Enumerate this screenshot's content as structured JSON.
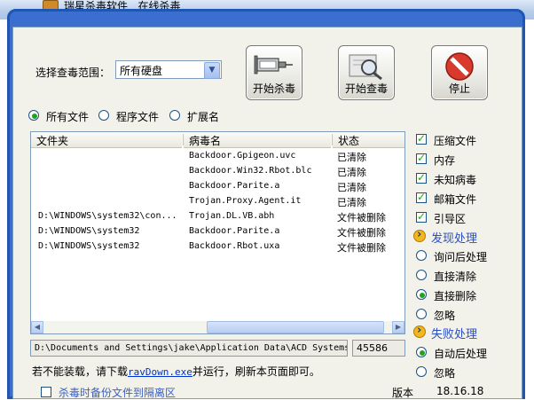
{
  "title": {
    "app": "瑞星杀毒软件",
    "sub": "在线杀毒"
  },
  "scan_scope": {
    "label": "选择查毒范围：",
    "value": "所有硬盘"
  },
  "buttons": {
    "start_kill": "开始杀毒",
    "start_scan": "开始查毒",
    "stop": "停止"
  },
  "file_types": {
    "all": "所有文件",
    "program": "程序文件",
    "ext": "扩展名",
    "selected": "all"
  },
  "table": {
    "headers": [
      "文件夹",
      "病毒名",
      "状态"
    ],
    "rows": [
      {
        "folder": "",
        "virus": "Backdoor.Gpigeon.uvc",
        "status": "已清除"
      },
      {
        "folder": "",
        "virus": "Backdoor.Win32.Rbot.blc",
        "status": "已清除"
      },
      {
        "folder": "",
        "virus": "Backdoor.Parite.a",
        "status": "已清除"
      },
      {
        "folder": "",
        "virus": "Trojan.Proxy.Agent.it",
        "status": "已清除"
      },
      {
        "folder": "D:\\WINDOWS\\system32\\con...",
        "virus": "Trojan.DL.VB.abh",
        "status": "文件被删除"
      },
      {
        "folder": "D:\\WINDOWS\\system32",
        "virus": "Backdoor.Parite.a",
        "status": "文件被删除"
      },
      {
        "folder": "D:\\WINDOWS\\system32",
        "virus": "Backdoor.Rbot.uxa",
        "status": "文件被删除"
      }
    ]
  },
  "status_bar": {
    "path": "D:\\Documents and Settings\\jake\\Application Data\\ACD Systems",
    "count": "45586"
  },
  "options": {
    "checks": [
      {
        "label": "压缩文件",
        "checked": true
      },
      {
        "label": "内存",
        "checked": true
      },
      {
        "label": "未知病毒",
        "checked": true
      },
      {
        "label": "邮箱文件",
        "checked": true
      },
      {
        "label": "引导区",
        "checked": true
      }
    ],
    "found_title": "发现处理",
    "found_options": [
      {
        "label": "询问后处理",
        "checked": false
      },
      {
        "label": "直接清除",
        "checked": false
      },
      {
        "label": "直接删除",
        "checked": true
      },
      {
        "label": "忽略",
        "checked": false
      }
    ],
    "fail_title": "失败处理",
    "fail_options": [
      {
        "label": "自动后处理",
        "checked": true
      },
      {
        "label": "忽略",
        "checked": false
      }
    ]
  },
  "notice": {
    "before": "若不能装载，请下载",
    "link": "ravDown.exe",
    "after": "并运行，刷新本页面即可。"
  },
  "bottom": {
    "left": "杀毒时备份文件到隔离区",
    "right_label": "版本",
    "right_value": "18.16.18"
  },
  "colors": {
    "frame": "#1f55b4",
    "accent_section": "#2a4fc4",
    "stop_red": "#d83a2e"
  }
}
